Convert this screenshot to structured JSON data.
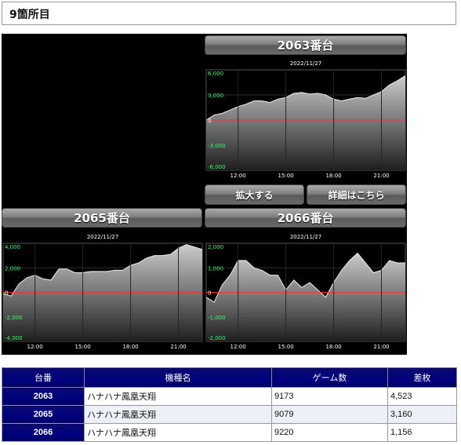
{
  "header": {
    "title": "9箇所目"
  },
  "charts": [
    {
      "title": "2063番台",
      "date": "2022/11/27",
      "yticks": [
        "6,000",
        "3,000",
        "0",
        "-3,000",
        "-6,000"
      ],
      "xticks": [
        "12:00",
        "15:00",
        "18:00",
        "21:00"
      ],
      "zoom_label": "拡大する",
      "detail_label": "詳細はこちら"
    },
    {
      "title": "2065番台",
      "date": "2022/11/27",
      "yticks": [
        "4,000",
        "2,000",
        "0",
        "-2,000",
        "-4,000"
      ],
      "xticks": [
        "12:00",
        "15:00",
        "18:00",
        "21:00"
      ]
    },
    {
      "title": "2066番台",
      "date": "2022/11/27",
      "yticks": [
        "2,000",
        "1,000",
        "0",
        "-1,000",
        "-2,000"
      ],
      "xticks": [
        "12:00",
        "15:00",
        "18:00",
        "21:00"
      ]
    }
  ],
  "chart_data": [
    {
      "type": "area",
      "title": "2063番台",
      "ylim": [
        -6000,
        6000
      ],
      "x": [
        "10:00",
        "10:30",
        "11:00",
        "11:30",
        "12:00",
        "12:30",
        "13:00",
        "13:30",
        "14:00",
        "14:30",
        "15:00",
        "15:30",
        "16:00",
        "16:30",
        "17:00",
        "17:30",
        "18:00",
        "18:30",
        "19:00",
        "19:30",
        "20:00",
        "20:30",
        "21:00",
        "21:30",
        "22:00",
        "22:30"
      ],
      "values": [
        0,
        600,
        800,
        1200,
        1600,
        1900,
        2300,
        2300,
        2100,
        2500,
        2700,
        3200,
        3300,
        3100,
        3200,
        3000,
        2500,
        2300,
        2500,
        2700,
        2600,
        3000,
        3400,
        4200,
        4700,
        5300
      ]
    },
    {
      "type": "area",
      "title": "2065番台",
      "ylim": [
        -4000,
        4000
      ],
      "x": [
        "10:00",
        "10:30",
        "11:00",
        "11:30",
        "12:00",
        "12:30",
        "13:00",
        "13:30",
        "14:00",
        "14:30",
        "15:00",
        "15:30",
        "16:00",
        "16:30",
        "17:00",
        "17:30",
        "18:00",
        "18:30",
        "19:00",
        "19:30",
        "20:00",
        "20:30",
        "21:00",
        "21:30",
        "22:00",
        "22:30"
      ],
      "values": [
        -100,
        -300,
        700,
        1200,
        1400,
        1100,
        1000,
        1900,
        1900,
        1600,
        1600,
        1700,
        1700,
        1700,
        1800,
        1800,
        2200,
        2400,
        2800,
        3000,
        3000,
        3100,
        3600,
        3900,
        3700,
        3500
      ]
    },
    {
      "type": "area",
      "title": "2066番台",
      "ylim": [
        -2000,
        2000
      ],
      "x": [
        "10:00",
        "10:30",
        "11:00",
        "11:30",
        "12:00",
        "12:30",
        "13:00",
        "13:30",
        "14:00",
        "14:30",
        "15:00",
        "15:30",
        "16:00",
        "16:30",
        "17:00",
        "17:30",
        "18:00",
        "18:30",
        "19:00",
        "19:30",
        "20:00",
        "20:30",
        "21:00",
        "21:30",
        "22:00",
        "22:30"
      ],
      "values": [
        -200,
        -400,
        300,
        700,
        1300,
        1300,
        1000,
        900,
        700,
        700,
        100,
        500,
        200,
        400,
        100,
        -200,
        400,
        900,
        1300,
        1600,
        1200,
        800,
        900,
        1300,
        1200,
        1200
      ]
    }
  ],
  "table": {
    "headers": [
      "台番",
      "機種名",
      "ゲーム数",
      "差枚"
    ],
    "rows": [
      {
        "no": "2063",
        "model": "ハナハナ鳳凰天翔",
        "games": "9173",
        "diff": "4,523"
      },
      {
        "no": "2065",
        "model": "ハナハナ鳳凰天翔",
        "games": "9079",
        "diff": "3,160"
      },
      {
        "no": "2066",
        "model": "ハナハナ鳳凰天翔",
        "games": "9220",
        "diff": "1,156"
      }
    ]
  },
  "colors": {
    "panel_bg": "#000000",
    "zero_line": "#ff3030",
    "ytick_positive": "#33ff66",
    "ytick_negative": "#33ff66",
    "table_header": "#000080",
    "area_fill_top": "#c8c8c8"
  }
}
